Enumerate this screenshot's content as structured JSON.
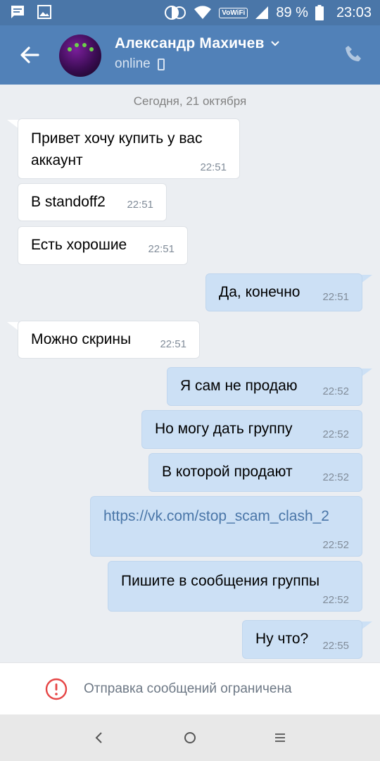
{
  "status_bar": {
    "battery_percent": "89 %",
    "time": "23:03",
    "wifi_label": "VoWiFi",
    "icons": [
      "message-icon",
      "image-icon",
      "data-saver-icon",
      "wifi-icon",
      "signal-icon",
      "battery-icon"
    ]
  },
  "header": {
    "contact_name": "Александр Махичев",
    "status": "online",
    "icons": [
      "back-arrow-icon",
      "chevron-down-icon",
      "mobile-icon",
      "phone-icon"
    ]
  },
  "chat": {
    "date_label": "Сегодня, 21 октября",
    "messages": [
      {
        "dir": "in",
        "text": "Привет хочу купить у вас аккаунт",
        "time": "22:51"
      },
      {
        "dir": "in",
        "text": "В standoff2",
        "time": "22:51"
      },
      {
        "dir": "in",
        "text": "Есть хорошие",
        "time": "22:51"
      },
      {
        "dir": "out",
        "text": "Да, конечно",
        "time": "22:51"
      },
      {
        "dir": "in",
        "text": "Можно скрины",
        "time": "22:51"
      },
      {
        "dir": "out",
        "text": "Я сам не продаю",
        "time": "22:52"
      },
      {
        "dir": "out",
        "text": "Но могу дать группу",
        "time": "22:52"
      },
      {
        "dir": "out",
        "text": "В которой продают",
        "time": "22:52"
      },
      {
        "dir": "out",
        "text": "https://vk.com/stop_scam_clash_2",
        "time": "22:52",
        "link": true
      },
      {
        "dir": "out",
        "text": "Пишите в сообщения группы",
        "time": "22:52"
      },
      {
        "dir": "out",
        "text": "Ну что?",
        "time": "22:55"
      }
    ]
  },
  "restriction": {
    "text": "Отправка сообщений ограничена",
    "icon": "alert-circle-icon",
    "color": "#e64646"
  },
  "navbar": {
    "icons": [
      "back-nav-icon",
      "home-nav-icon",
      "menu-nav-icon"
    ]
  },
  "colors": {
    "status_bar": "#4a76a8",
    "header": "#5181b8",
    "chat_background": "#ebeef2",
    "incoming_bubble": "#ffffff",
    "outgoing_bubble": "#cce0f5",
    "link": "#4a76a8"
  }
}
